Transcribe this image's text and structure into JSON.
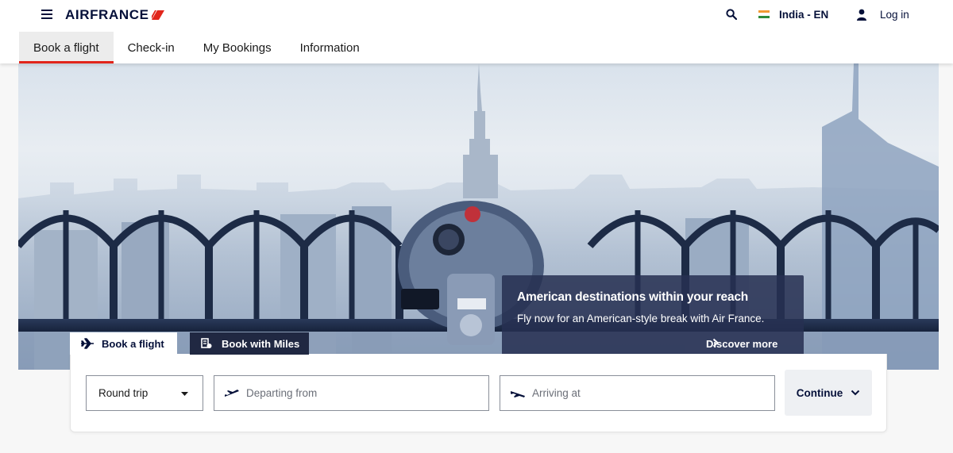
{
  "brand": {
    "name": "AIRFRANCE",
    "accent_color": "#e1251b",
    "navy_color": "#051039"
  },
  "header": {
    "menu_icon": "hamburger-menu-icon",
    "search_icon": "search-icon",
    "locale_label": "India - EN",
    "locale_icon": "india-flag-icon",
    "login_label": "Log in",
    "login_icon": "user-icon"
  },
  "nav": {
    "tabs": [
      {
        "label": "Book a flight",
        "active": true
      },
      {
        "label": "Check-in",
        "active": false
      },
      {
        "label": "My Bookings",
        "active": false
      },
      {
        "label": "Information",
        "active": false
      }
    ]
  },
  "promo": {
    "title": "American destinations within your reach",
    "text": "Fly now for an American-style break with Air France.",
    "link_label": "Discover more"
  },
  "booking": {
    "tabs": [
      {
        "label": "Book a flight",
        "icon": "airplane-icon",
        "active": true
      },
      {
        "label": "Book with Miles",
        "icon": "miles-icon",
        "active": false
      }
    ],
    "trip_type": "Round trip",
    "departing_placeholder": "Departing from",
    "arriving_placeholder": "Arriving at",
    "continue_label": "Continue"
  }
}
